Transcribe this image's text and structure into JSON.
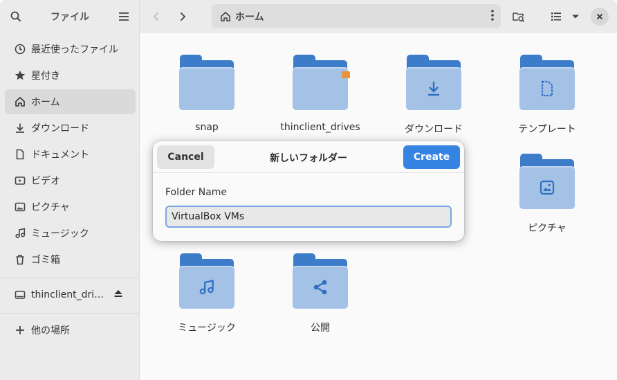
{
  "sidebar": {
    "title": "ファイル",
    "items": [
      {
        "label": "最近使ったファイル",
        "icon": "clock-icon"
      },
      {
        "label": "星付き",
        "icon": "star-icon"
      },
      {
        "label": "ホーム",
        "icon": "home-icon"
      },
      {
        "label": "ダウンロード",
        "icon": "download-icon"
      },
      {
        "label": "ドキュメント",
        "icon": "document-icon"
      },
      {
        "label": "ビデオ",
        "icon": "video-icon"
      },
      {
        "label": "ピクチャ",
        "icon": "picture-icon"
      },
      {
        "label": "ミュージック",
        "icon": "music-icon"
      },
      {
        "label": "ゴミ箱",
        "icon": "trash-icon"
      }
    ],
    "drive": {
      "label": "thinclient_dri…",
      "icon": "drive-icon"
    },
    "other": {
      "label": "他の場所",
      "icon": "plus-icon"
    },
    "active_index": 2
  },
  "header": {
    "path": "ホーム",
    "path_icon": "home-icon"
  },
  "folders": [
    {
      "name": "snap",
      "glyph": "none"
    },
    {
      "name": "thinclient_drives",
      "glyph": "none"
    },
    {
      "name": "ダウンロード",
      "glyph": "download-icon"
    },
    {
      "name": "テンプレート",
      "glyph": "template-icon"
    },
    {
      "name": "ピクチャ",
      "glyph": "picture-icon"
    },
    {
      "name": "ミュージック",
      "glyph": "music-icon"
    },
    {
      "name": "公開",
      "glyph": "share-icon"
    }
  ],
  "dialog": {
    "title": "新しいフォルダー",
    "cancel_label": "Cancel",
    "create_label": "Create",
    "field_label": "Folder Name",
    "field_value": "VirtualBox VMs"
  },
  "colors": {
    "accent": "#3584e4",
    "folder_dark": "#3d7cc9",
    "folder_light": "#a4c1e6"
  }
}
